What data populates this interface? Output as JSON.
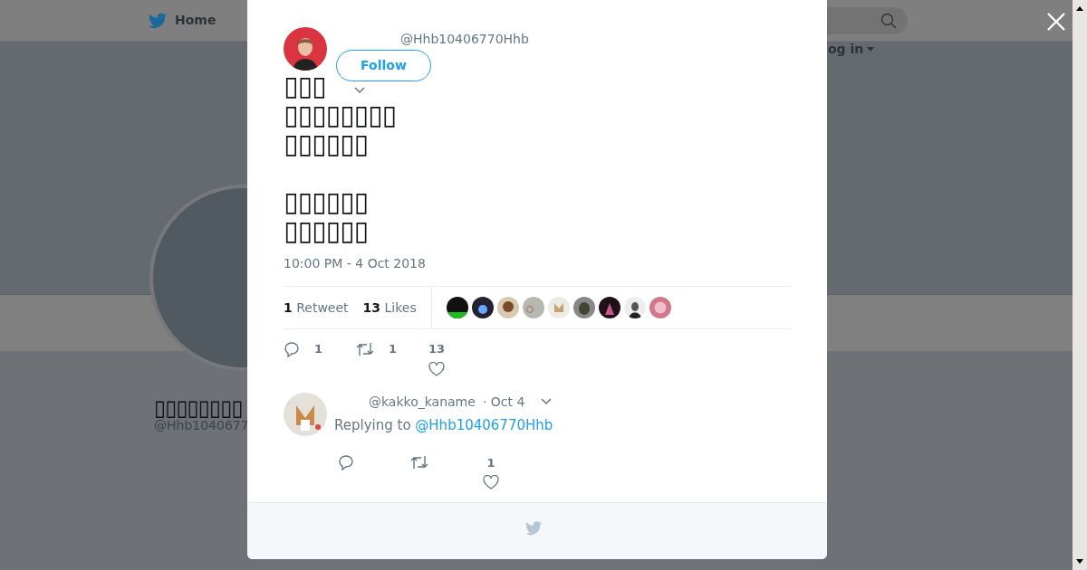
{
  "background_page": {
    "nav": {
      "home": "Home",
      "login": "og in"
    },
    "profile": {
      "name": "▯▯▯▯▯▯▯▯",
      "handle": "@Hhb1040677"
    }
  },
  "tweet": {
    "handle": "@Hhb10406770Hhb",
    "follow": "Follow",
    "paragraphs": [
      [
        "▯▯▯",
        "▯▯▯▯▯▯▯▯",
        "▯▯▯▯▯▯"
      ],
      [
        "▯▯▯▯▯▯",
        "▯▯▯▯▯▯"
      ]
    ],
    "timestamp": "10:00 PM - 4 Oct 2018",
    "stats": {
      "retweet_count": "1",
      "retweet_label": "Retweet",
      "likes_count": "13",
      "likes_label": "Likes"
    },
    "actions": {
      "replies": "1",
      "retweets": "1",
      "likes": "13"
    }
  },
  "reply": {
    "handle": "@kakko_kaname",
    "time": "· Oct 4",
    "replying_prefix": "Replying to",
    "replying_to": "@Hhb10406770Hhb",
    "likes": "1"
  }
}
